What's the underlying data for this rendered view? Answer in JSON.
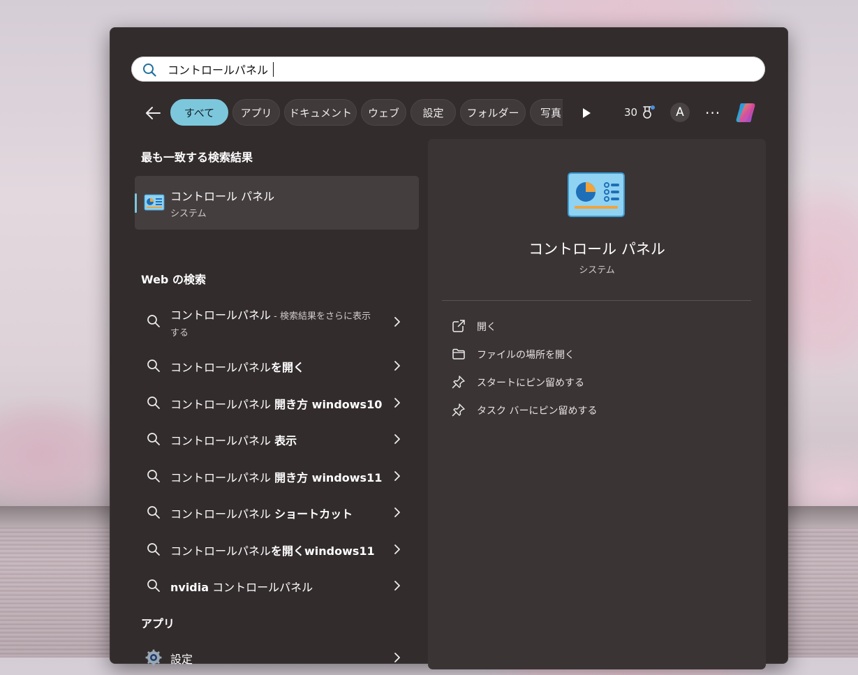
{
  "search": {
    "value": "コントロールパネル",
    "placeholder": ""
  },
  "filters": {
    "chips": [
      "すべて",
      "アプリ",
      "ドキュメント",
      "ウェブ",
      "設定",
      "フォルダー",
      "写真"
    ],
    "active": "すべて",
    "points": "30",
    "avatar_letter": "A",
    "more": "···"
  },
  "best_match": {
    "heading": "最も一致する検索結果",
    "name": "コントロール パネル",
    "sub": "システム"
  },
  "web": {
    "heading": "Web の検索",
    "first": {
      "prefix": "コントロールパネル",
      "hint": " - 検索結果をさらに表示",
      "hint2": "する"
    },
    "items": [
      {
        "prefix": "コントロールパネル",
        "bold": "を開く"
      },
      {
        "prefix": "コントロールパネル ",
        "bold": "開き方 windows10"
      },
      {
        "prefix": "コントロールパネル ",
        "bold": "表示"
      },
      {
        "prefix": "コントロールパネル ",
        "bold": "開き方 windows11"
      },
      {
        "prefix": "コントロールパネル ",
        "bold": "ショートカット"
      },
      {
        "prefix": "コントロールパネル",
        "bold": "を開くwindows11"
      },
      {
        "prefix_bold": "nvidia",
        "rest": " コントロールパネル"
      }
    ]
  },
  "apps": {
    "heading": "アプリ",
    "items": [
      {
        "label": "設定",
        "icon": "gear-icon"
      }
    ]
  },
  "detail": {
    "title": "コントロール パネル",
    "sub": "システム",
    "actions": [
      {
        "label": "開く",
        "icon": "open-external-icon"
      },
      {
        "label": "ファイルの場所を開く",
        "icon": "folder-icon"
      },
      {
        "label": "スタートにピン留めする",
        "icon": "pin-icon"
      },
      {
        "label": "タスク バーにピン留めする",
        "icon": "pin-icon"
      }
    ]
  },
  "colors": {
    "accent": "#7dc7dc",
    "panel": "#332c2d",
    "detail_bg": "#3b3435"
  }
}
